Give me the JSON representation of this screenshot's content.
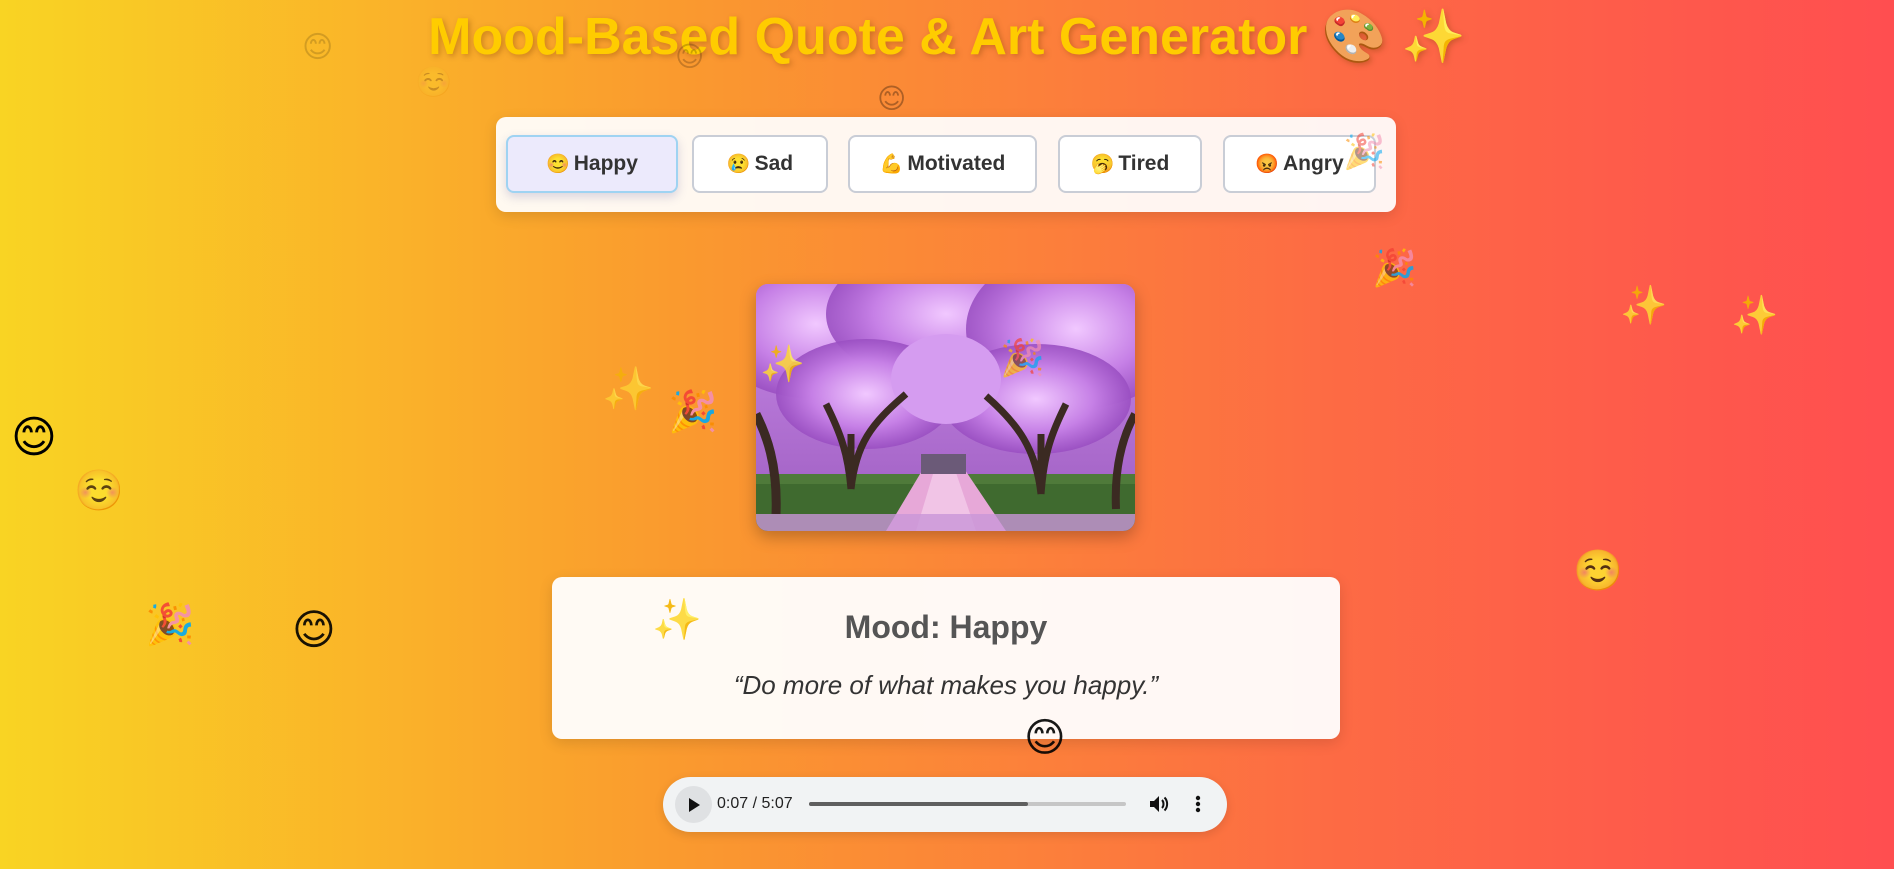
{
  "app": {
    "title": "Mood-Based Quote & Art Generator",
    "title_emoji": "🎨 ✨"
  },
  "moods": [
    {
      "emoji": "😊",
      "label": "Happy",
      "active": true
    },
    {
      "emoji": "😢",
      "label": "Sad",
      "active": false
    },
    {
      "emoji": "💪",
      "label": "Motivated",
      "active": false
    },
    {
      "emoji": "🥱",
      "label": "Tired",
      "active": false
    },
    {
      "emoji": "😡",
      "label": "Angry",
      "active": false
    }
  ],
  "art": {
    "image": "cherry-blossom-path"
  },
  "quote_card": {
    "mood_prefix": "Mood: ",
    "mood": "Happy",
    "quote": "“Do more of what makes you happy.”"
  },
  "audio": {
    "current_time": "0:07",
    "duration": "5:07",
    "time_display": "0:07 / 5:07",
    "progress_fraction": 0.69
  },
  "floating_emojis": [
    "😊",
    "☺️",
    "🎉",
    "✨"
  ],
  "colors": {
    "title": "#ffcc00",
    "gradient_start": "#f9d423",
    "gradient_end": "#ff4e50",
    "active_button": "#eceafc"
  }
}
